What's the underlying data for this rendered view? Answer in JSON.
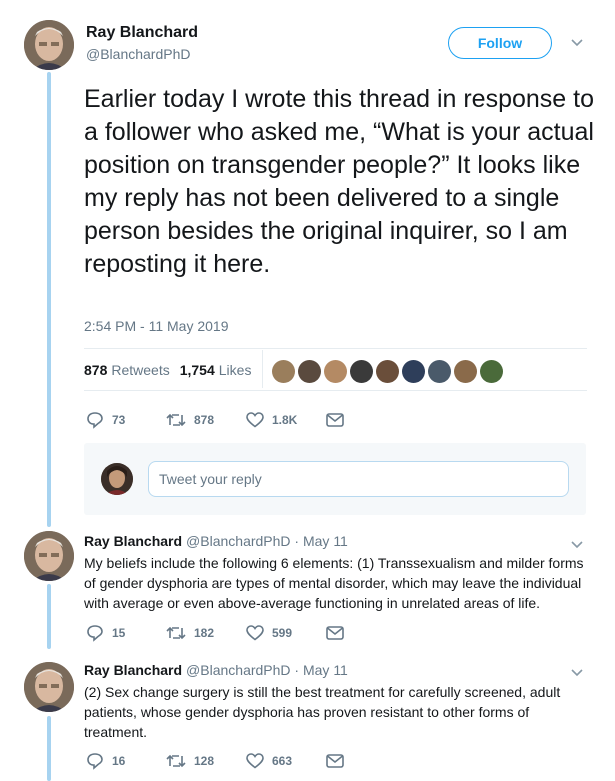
{
  "tweet": {
    "author_name": "Ray Blanchard",
    "author_handle": "@BlanchardPhD",
    "follow_label": "Follow",
    "text": "Earlier today I wrote this thread in response to a follower who asked me, “What is your actual position on transgender people?” It looks like my reply has not been delivered to a single person besides the original inquirer, so I am reposting it here.",
    "timestamp": "2:54 PM - 11 May 2019",
    "retweets_count": "878",
    "retweets_label": "Retweets",
    "likes_count": "1,754",
    "likes_label": "Likes",
    "liker_colors": [
      "#9a7e5c",
      "#5a4a3e",
      "#b48a64",
      "#3a3a3a",
      "#6a4e3a",
      "#2e3e5a",
      "#4a5a6a",
      "#8a6a4a",
      "#4a6a3a"
    ],
    "actions": {
      "replies": "73",
      "retweets": "878",
      "likes": "1.8K"
    }
  },
  "reply_box": {
    "placeholder": "Tweet your reply"
  },
  "replies": [
    {
      "author_name": "Ray Blanchard",
      "meta": "@BlanchardPhD · May 11",
      "text": "My beliefs include the following 6 elements: (1) Transsexualism and milder forms of gender dysphoria are types of mental disorder, which may leave the individual with average or even above-average functioning in unrelated areas of life.",
      "actions": {
        "replies": "15",
        "retweets": "182",
        "likes": "599"
      }
    },
    {
      "author_name": "Ray Blanchard",
      "meta": "@BlanchardPhD · May 11",
      "text": "(2) Sex change surgery is still the best treatment for carefully screened, adult patients, whose gender dysphoria has proven resistant to other forms of treatment.",
      "actions": {
        "replies": "16",
        "retweets": "128",
        "likes": "663"
      }
    }
  ]
}
